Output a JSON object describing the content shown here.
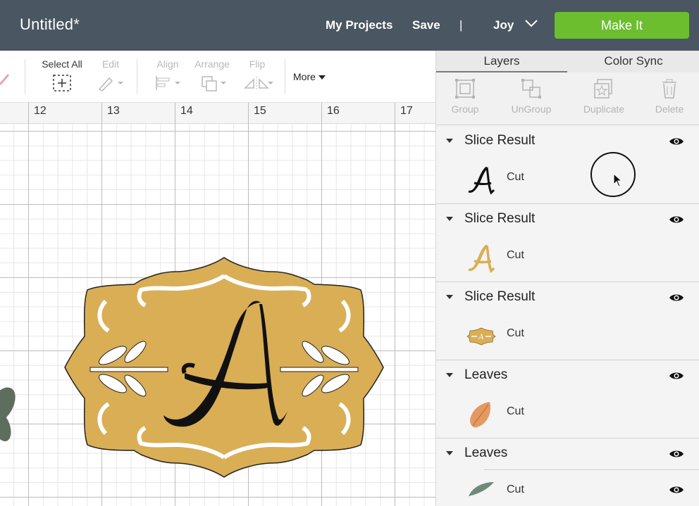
{
  "app": {
    "title": "Untitled*"
  },
  "header": {
    "my_projects": "My Projects",
    "save": "Save",
    "separator": "|",
    "user": "Joy",
    "make_it": "Make It",
    "accent_color": "#6cbe2f"
  },
  "toolbar": {
    "select_all": "Select All",
    "edit": "Edit",
    "align": "Align",
    "arrange": "Arrange",
    "flip": "Flip",
    "more": "More"
  },
  "ruler": {
    "marks": [
      "12",
      "13",
      "14",
      "15",
      "16",
      "17"
    ]
  },
  "panel": {
    "tabs": [
      {
        "label": "Layers",
        "active": true
      },
      {
        "label": "Color Sync",
        "active": false
      }
    ],
    "tools": {
      "group": "Group",
      "ungroup": "UnGroup",
      "duplicate": "Duplicate",
      "delete": "Delete"
    },
    "layers": [
      {
        "name": "Slice Result",
        "operation": "Cut",
        "thumb": "script-a-black"
      },
      {
        "name": "Slice Result",
        "operation": "Cut",
        "thumb": "script-a-gold"
      },
      {
        "name": "Slice Result",
        "operation": "Cut",
        "thumb": "label-frame-gold"
      },
      {
        "name": "Leaves",
        "operation": "Cut",
        "thumb": "leaf-orange"
      },
      {
        "name": "Leaves",
        "operation": "Cut",
        "thumb": "leaf-green"
      }
    ]
  },
  "design": {
    "letter": "A",
    "frame_color": "#d9ae55",
    "ink_color": "#111111"
  }
}
